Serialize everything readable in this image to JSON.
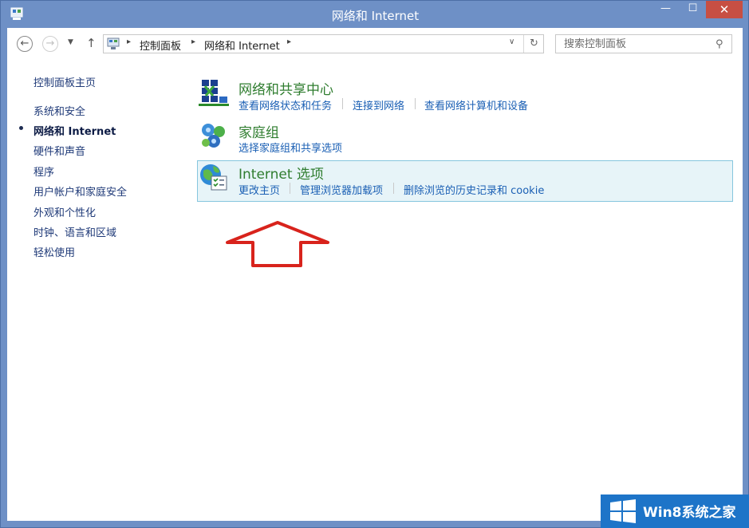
{
  "window": {
    "title": "网络和 Internet",
    "minimize": "—",
    "maximize": "☐",
    "close": "✕"
  },
  "nav": {
    "back": "←",
    "forward": "→",
    "history": "▼",
    "up": "↑",
    "breadcrumb": [
      "控制面板",
      "网络和 Internet"
    ],
    "breadcrumb_sep": "▸",
    "address_dropdown": "∨",
    "refresh": "↻"
  },
  "search": {
    "placeholder": "搜索控制面板",
    "icon": "⚲"
  },
  "sidebar": {
    "home": "控制面板主页",
    "items": [
      {
        "label": "系统和安全",
        "active": false
      },
      {
        "label": "网络和 Internet",
        "active": true
      },
      {
        "label": "硬件和声音",
        "active": false
      },
      {
        "label": "程序",
        "active": false
      },
      {
        "label": "用户帐户和家庭安全",
        "active": false
      },
      {
        "label": "外观和个性化",
        "active": false
      },
      {
        "label": "时钟、语言和区域",
        "active": false
      },
      {
        "label": "轻松使用",
        "active": false
      }
    ]
  },
  "categories": [
    {
      "title": "网络和共享中心",
      "icon": "network-sharing-icon",
      "links": [
        "查看网络状态和任务",
        "连接到网络",
        "查看网络计算机和设备"
      ]
    },
    {
      "title": "家庭组",
      "icon": "homegroup-icon",
      "links": [
        "选择家庭组和共享选项"
      ]
    },
    {
      "title": "Internet 选项",
      "icon": "internet-options-icon",
      "links": [
        "更改主页",
        "管理浏览器加载项",
        "删除浏览的历史记录和 cookie"
      ],
      "highlighted": true
    }
  ],
  "watermark": {
    "text": "Win8系统之家"
  },
  "colors": {
    "frame": "#6e90c6",
    "close": "#c74f43",
    "category_title": "#2f7d2f",
    "link": "#1a5fb4",
    "annotation_arrow": "#d8231c",
    "highlight": "#e7f4f8"
  }
}
